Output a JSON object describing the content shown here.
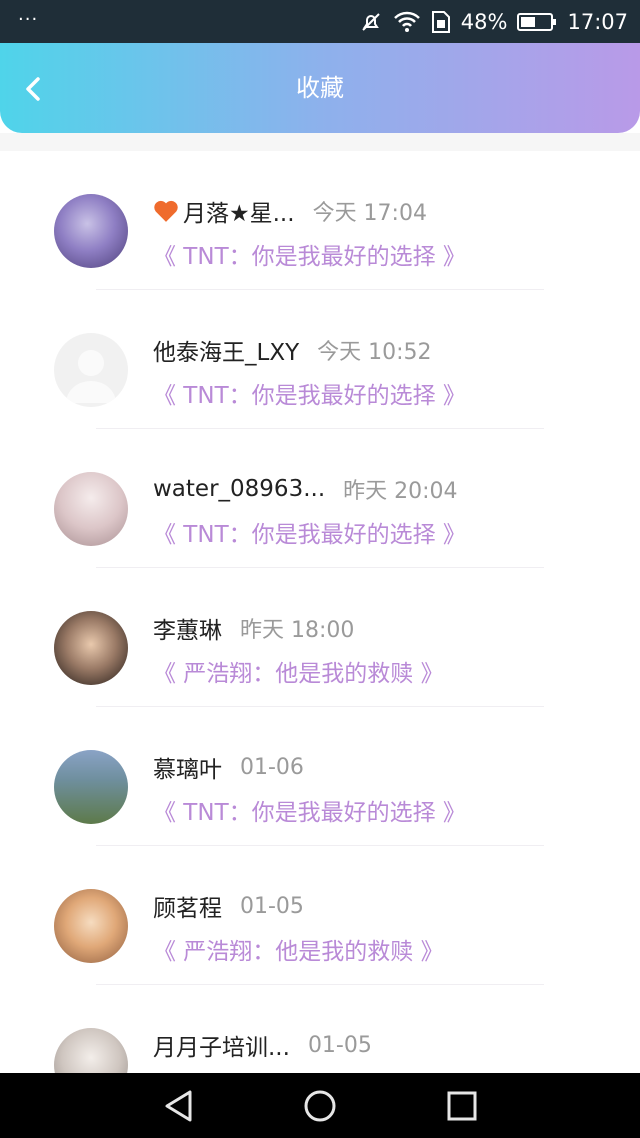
{
  "status_bar": {
    "dots": "···",
    "battery": "48%",
    "time": "17:07"
  },
  "header": {
    "title": "收藏"
  },
  "items": [
    {
      "name": "月落★星...",
      "time": "今天 17:04",
      "subtitle": "《 TNT：你是我最好的选择 》",
      "has_heart": true,
      "avatar_colors": [
        "#6f5fa8",
        "#c9c2e6"
      ]
    },
    {
      "name": "他泰海王_LXY",
      "time": "今天 10:52",
      "subtitle": "《 TNT：你是我最好的选择 》",
      "has_heart": false,
      "avatar_colors": [
        "#eeeeee",
        "#f7f7f7"
      ]
    },
    {
      "name": "water_08963...",
      "time": "昨天 20:04",
      "subtitle": "《 TNT：你是我最好的选择 》",
      "has_heart": false,
      "avatar_colors": [
        "#d8c2c4",
        "#efe4e4"
      ]
    },
    {
      "name": "李蕙琳",
      "time": "昨天 18:00",
      "subtitle": "《 严浩翔：他是我的救赎 》",
      "has_heart": false,
      "avatar_colors": [
        "#3a2e2a",
        "#e5c3a7"
      ]
    },
    {
      "name": "慕璃叶",
      "time": "01-06",
      "subtitle": "《 TNT：你是我最好的选择 》",
      "has_heart": false,
      "avatar_colors": [
        "#5d7a4a",
        "#8aa3c6"
      ]
    },
    {
      "name": "顾茗程",
      "time": "01-05",
      "subtitle": "《 严浩翔：他是我的救赎 》",
      "has_heart": false,
      "avatar_colors": [
        "#f0c79b",
        "#8b5a3c"
      ]
    },
    {
      "name": "月月子培训...",
      "time": "01-05",
      "subtitle": "",
      "has_heart": false,
      "avatar_colors": [
        "#c7c7c7",
        "#eeeeee"
      ]
    }
  ],
  "colors": {
    "header_gradient": [
      "#4fd4ea",
      "#b99ae8"
    ],
    "subtitle": "#b98ad7",
    "heart": "#ef6b2d"
  }
}
